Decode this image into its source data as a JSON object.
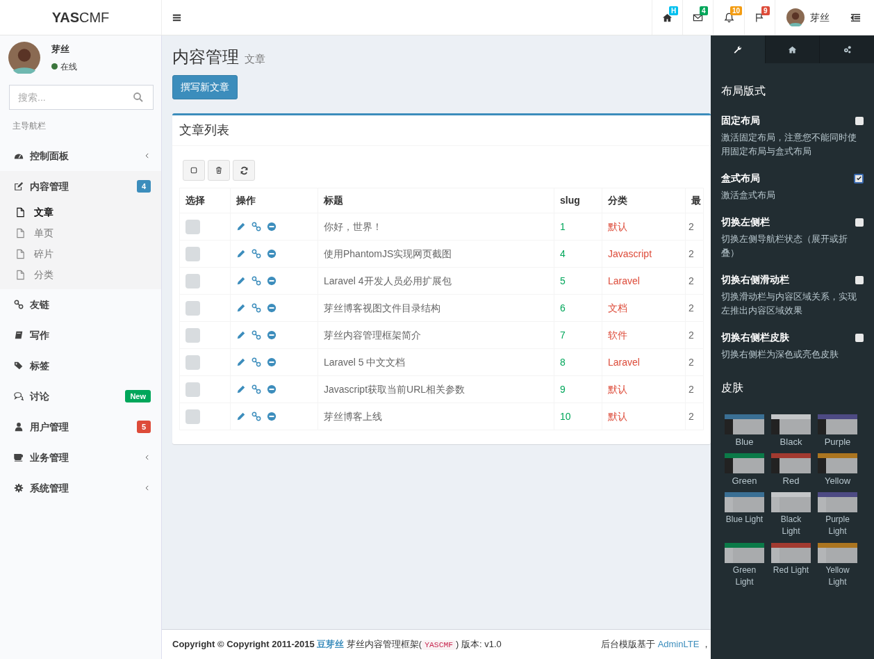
{
  "header": {
    "logo_bold": "YAS",
    "logo_light": "CMF",
    "notifications": [
      {
        "kind": "home",
        "badge": "H",
        "color": "#00c0ef"
      },
      {
        "kind": "envelope",
        "badge": "4",
        "color": "#00a65a"
      },
      {
        "kind": "bell",
        "badge": "10",
        "color": "#f39c12"
      },
      {
        "kind": "flag",
        "badge": "9",
        "color": "#dd4b39"
      }
    ],
    "user_name": "芽丝"
  },
  "sidebar": {
    "user": {
      "name": "芽丝",
      "status": "在线",
      "online": true
    },
    "search": {
      "placeholder": "搜索..."
    },
    "section_header": "主导航栏",
    "items": [
      {
        "kind": "dashboard",
        "label": "控制面板",
        "caret": true,
        "expanded": false
      },
      {
        "kind": "edit",
        "label": "内容管理",
        "badge": "4",
        "color": "#3c8dbc",
        "expanded": true,
        "children": [
          {
            "label": "文章",
            "selected": true
          },
          {
            "label": "单页",
            "selected": false
          },
          {
            "label": "碎片",
            "selected": false
          },
          {
            "label": "分类",
            "selected": false
          }
        ]
      },
      {
        "kind": "link",
        "label": "友链"
      },
      {
        "kind": "book",
        "label": "写作"
      },
      {
        "kind": "tags",
        "label": "标签"
      },
      {
        "kind": "comments",
        "label": "讨论",
        "badge": "New",
        "color": "#00a65a"
      },
      {
        "kind": "user",
        "label": "用户管理",
        "badge": "5",
        "color": "#dd4b39"
      },
      {
        "kind": "coffee",
        "label": "业务管理",
        "caret": true,
        "expanded": false
      },
      {
        "kind": "gear",
        "label": "系统管理",
        "caret": true,
        "expanded": false
      }
    ]
  },
  "content": {
    "title": "内容管理",
    "subtitle": "文章",
    "new_button": "撰写新文章",
    "box_title": "文章列表",
    "toolbar": [
      {
        "kind": "select"
      },
      {
        "kind": "delete"
      },
      {
        "kind": "refresh"
      }
    ],
    "table": {
      "columns": [
        "选择",
        "操作",
        "标题",
        "slug",
        "分类",
        "最"
      ],
      "rows": [
        {
          "checked": false,
          "title": "你好，世界！",
          "slug": "1",
          "category": "默认",
          "column_6": "2"
        },
        {
          "checked": false,
          "title": "使用PhantomJS实现网页截图",
          "slug": "4",
          "category": "Javascript",
          "column_6": "2"
        },
        {
          "checked": false,
          "title": "Laravel 4开发人员必用扩展包",
          "slug": "5",
          "category": "Laravel",
          "column_6": "2"
        },
        {
          "checked": false,
          "title": "芽丝博客视图文件目录结构",
          "slug": "6",
          "category": "文档",
          "column_6": "2"
        },
        {
          "checked": false,
          "title": "芽丝内容管理框架简介",
          "slug": "7",
          "category": "软件",
          "column_6": "2"
        },
        {
          "checked": false,
          "title": "Laravel 5 中文文档",
          "slug": "8",
          "category": "Laravel",
          "column_6": "2"
        },
        {
          "checked": false,
          "title": "Javascript获取当前URL相关参数",
          "slug": "9",
          "category": "默认",
          "column_6": "2"
        },
        {
          "checked": false,
          "title": "芽丝博客上线",
          "slug": "10",
          "category": "默认",
          "column_6": "2"
        }
      ]
    }
  },
  "footer": {
    "copyright": "Copyright © Copyright 2011-2015",
    "author_link": "豆芽丝",
    "product": "芽丝内容管理框架(",
    "code": "YASCMF",
    "version": ") 版本: v1.0",
    "based_on": "后台模版基于",
    "template_link": "AdminLTE",
    "trailing": "，"
  },
  "control_sidebar": {
    "tabs": [
      {
        "kind": "wrench",
        "selected": true
      },
      {
        "kind": "home",
        "selected": false
      },
      {
        "kind": "gears",
        "selected": false
      }
    ],
    "layout_heading": "布局版式",
    "options": [
      {
        "label": "固定布局",
        "description": "激活固定布局，注意您不能同时使用固定布局与盒式布局",
        "checked": false
      },
      {
        "label": "盒式布局",
        "description": "激活盒式布局",
        "checked": true
      },
      {
        "label": "切换左侧栏",
        "description": "切换左侧导航栏状态（展开或折叠）",
        "checked": false
      },
      {
        "label": "切换右侧滑动栏",
        "description": "切换滑动栏与内容区域关系，实现左推出内容区域效果",
        "checked": false
      },
      {
        "label": "切换右侧栏皮肤",
        "description": "切换右侧栏为深色或亮色皮肤",
        "checked": false
      }
    ],
    "skins_heading": "皮肤",
    "skins": [
      {
        "label": "Blue",
        "color": "#3a6f94",
        "light": false
      },
      {
        "label": "Black",
        "color": "#c4c6c8",
        "light": false
      },
      {
        "label": "Purple",
        "color": "#4d4a83",
        "light": false
      },
      {
        "label": "Green",
        "color": "#0b7a48",
        "light": false
      },
      {
        "label": "Red",
        "color": "#a23a30",
        "light": false
      },
      {
        "label": "Yellow",
        "color": "#ab7520",
        "light": false
      },
      {
        "label": "Blue Light",
        "color": "#3a6f94",
        "light": true
      },
      {
        "label": "Black Light",
        "color": "#c4c6c8",
        "light": true
      },
      {
        "label": "Purple Light",
        "color": "#4d4a83",
        "light": true
      },
      {
        "label": "Green Light",
        "color": "#0b7a48",
        "light": true
      },
      {
        "label": "Red Light",
        "color": "#a23a30",
        "light": true
      },
      {
        "label": "Yellow Light",
        "color": "#ab7520",
        "light": true
      }
    ]
  }
}
